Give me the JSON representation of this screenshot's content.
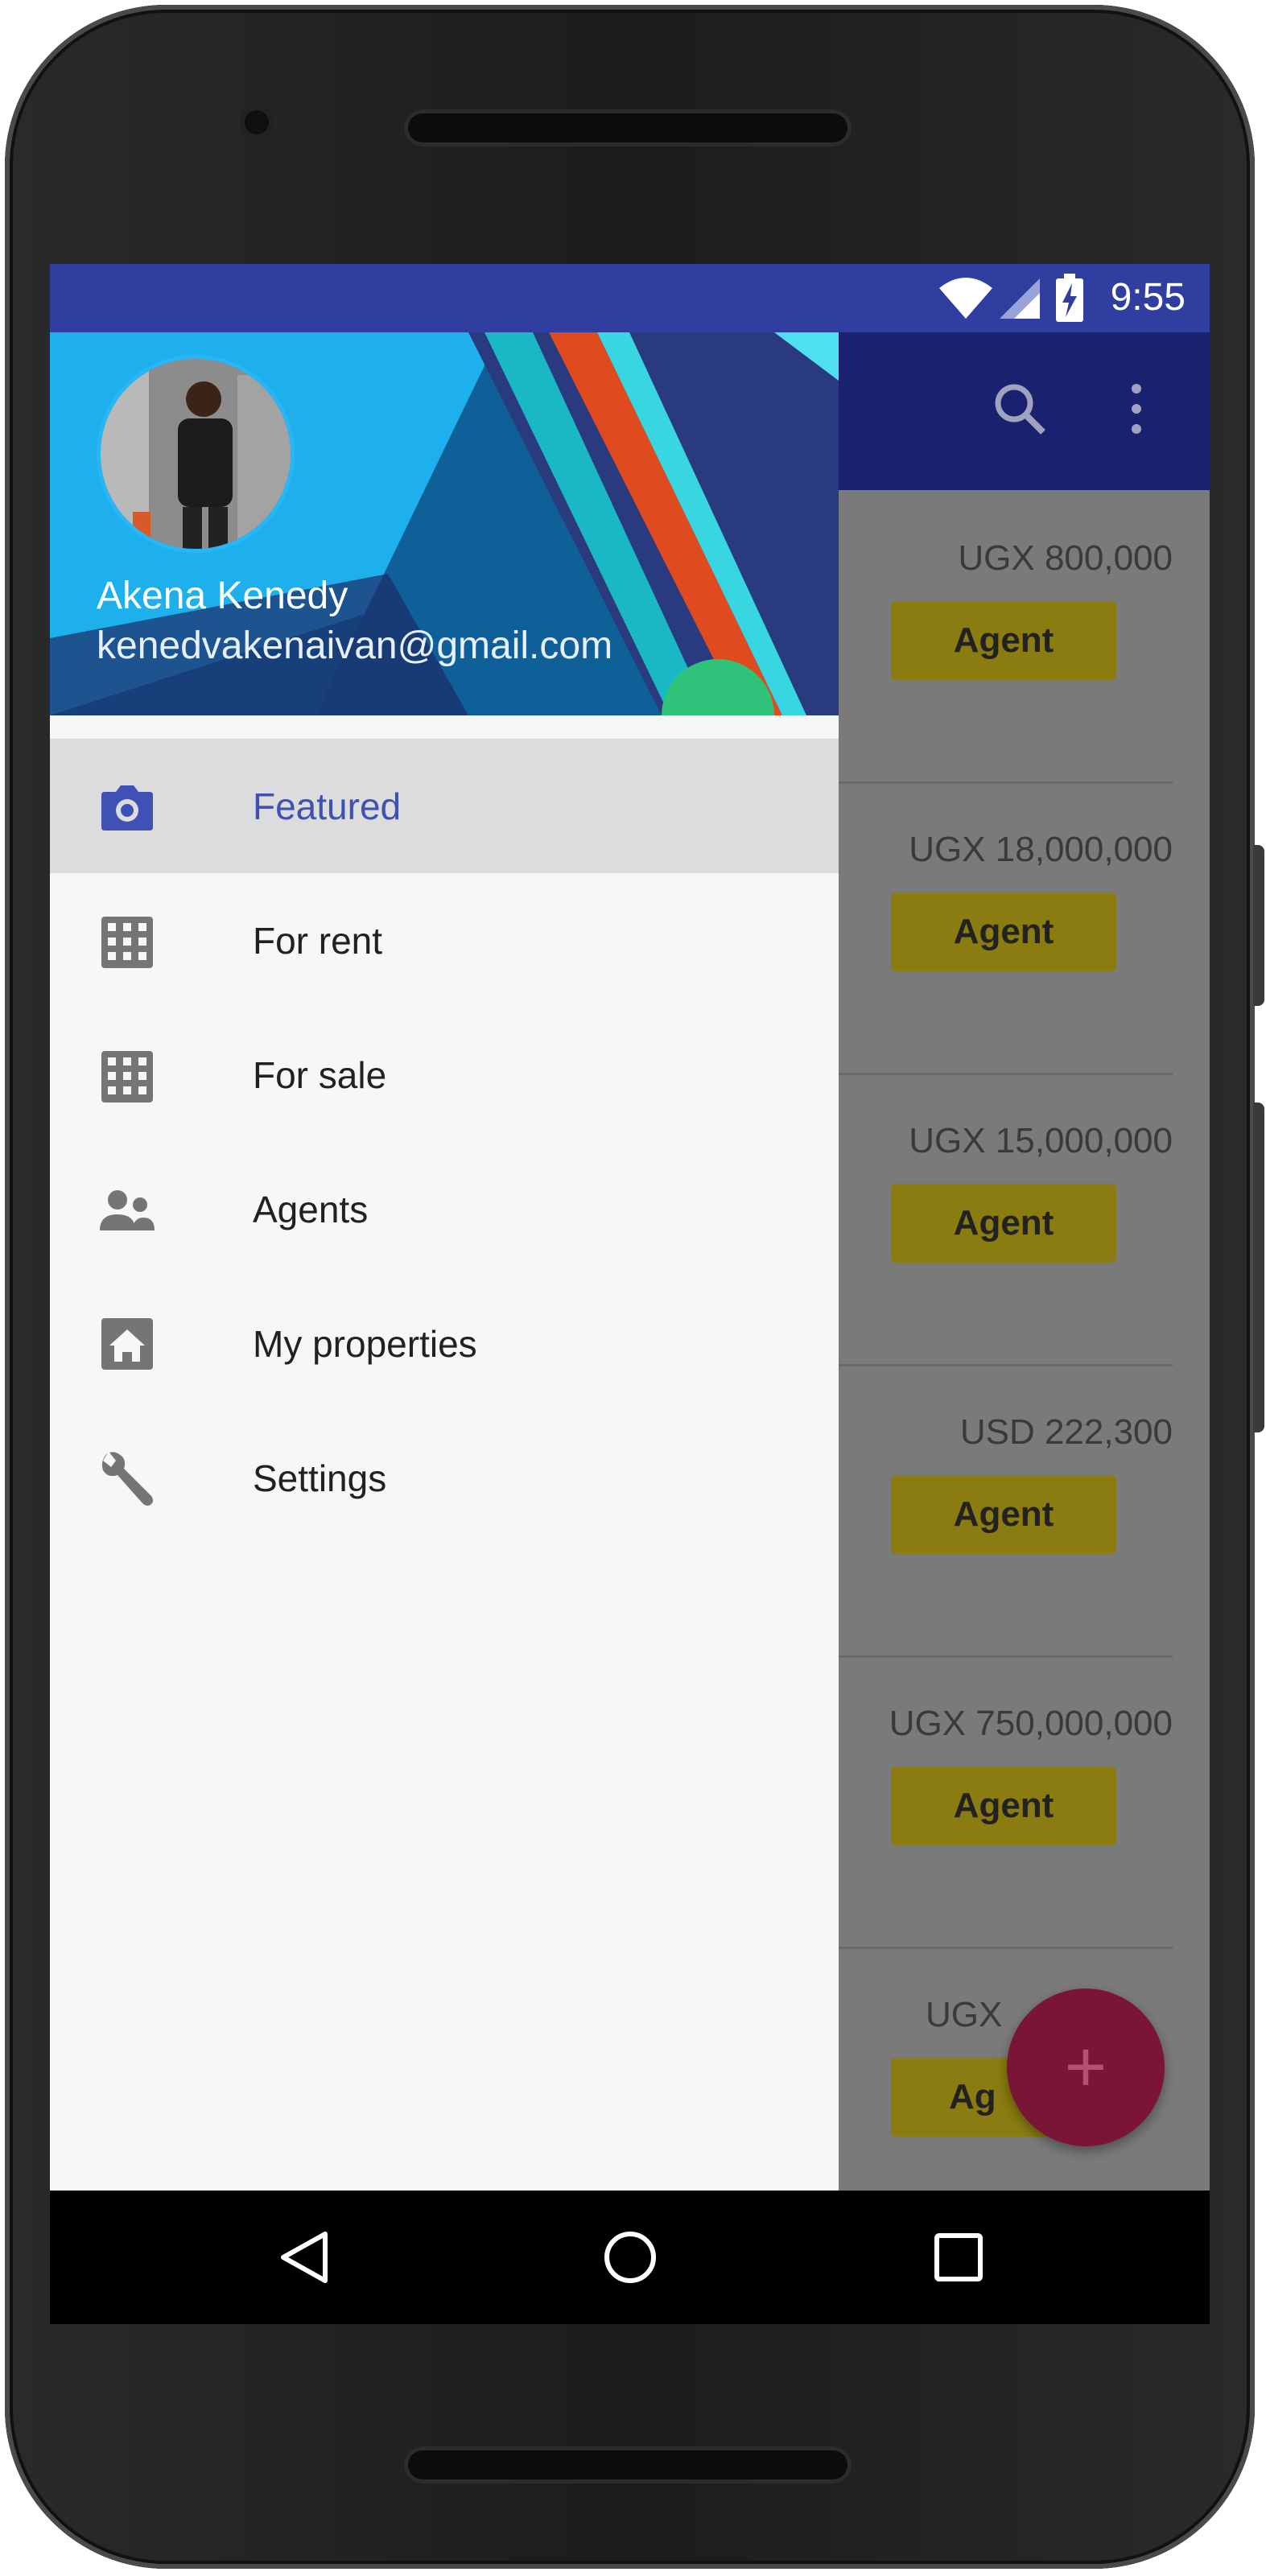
{
  "status_bar": {
    "time": "9:55",
    "icons": [
      "wifi-icon",
      "signal-icon",
      "battery-charging-icon"
    ]
  },
  "app_bar": {
    "actions": [
      "search-icon",
      "more-vert-icon"
    ]
  },
  "listings": [
    {
      "price": "UGX 800,000",
      "button": "Agent"
    },
    {
      "price": "UGX 18,000,000",
      "button": "Agent"
    },
    {
      "price": "UGX 15,000,000",
      "button": "Agent"
    },
    {
      "price": "USD 222,300",
      "button": "Agent"
    },
    {
      "price": "UGX 750,000,000",
      "button": "Agent"
    },
    {
      "price": "UGX",
      "button": "Ag"
    }
  ],
  "fab": {
    "label": "+"
  },
  "drawer": {
    "user": {
      "name": "Akena Kenedy",
      "email": "kenedvakenaivan@gmail.com"
    },
    "items": [
      {
        "label": "Featured",
        "icon": "camera-icon",
        "selected": true
      },
      {
        "label": "For rent",
        "icon": "building-icon",
        "selected": false
      },
      {
        "label": "For sale",
        "icon": "building-icon",
        "selected": false
      },
      {
        "label": "Agents",
        "icon": "people-icon",
        "selected": false
      },
      {
        "label": "My properties",
        "icon": "home-icon",
        "selected": false
      },
      {
        "label": "Settings",
        "icon": "wrench-icon",
        "selected": false
      }
    ]
  },
  "nav_bar": {
    "buttons": [
      "back-icon",
      "home-circle-icon",
      "recents-icon"
    ]
  },
  "colors": {
    "primary": "#303f9f",
    "accent_selected": "#3f51b5",
    "fab": "#7a1538",
    "agent_button": "#8a7c10"
  }
}
